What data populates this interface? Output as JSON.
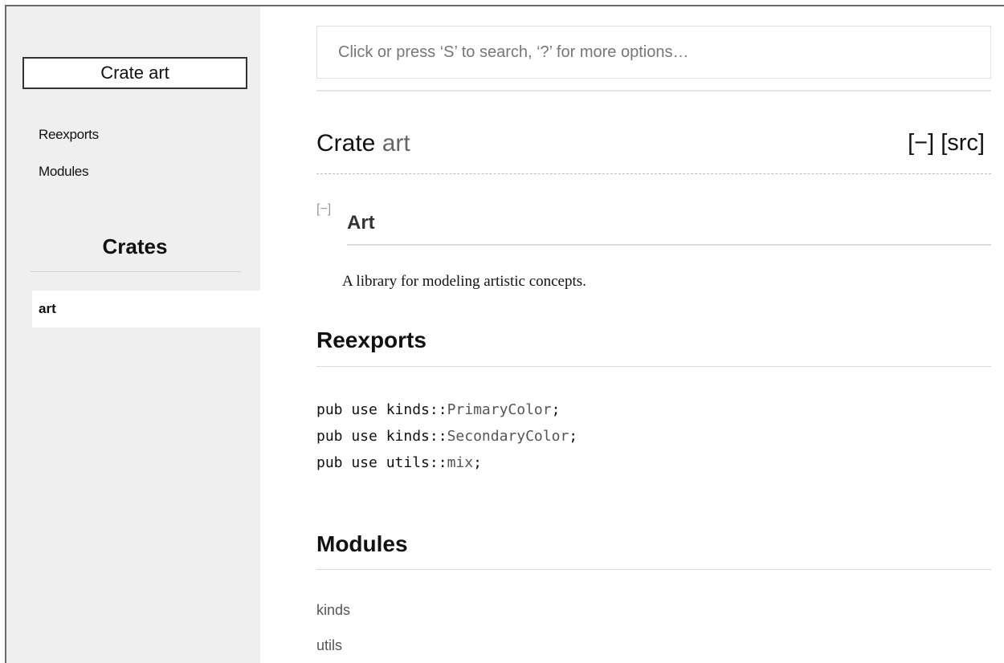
{
  "sidebar": {
    "crate_box_label": "Crate art",
    "links": [
      {
        "label": "Reexports"
      },
      {
        "label": "Modules"
      }
    ],
    "crates_heading": "Crates",
    "crates": [
      {
        "label": "art"
      }
    ]
  },
  "search": {
    "placeholder": "Click or press ‘S’ to search, ‘?’ for more options…"
  },
  "header": {
    "title_prefix": "Crate ",
    "title_name": "art",
    "collapse_label": "[−]",
    "src_label": "[src]"
  },
  "docblock": {
    "collapse_label": "[−]",
    "heading": "Art",
    "text": "A library for modeling artistic concepts."
  },
  "reexports": {
    "heading": "Reexports",
    "lines": [
      {
        "prefix": "pub use kinds::",
        "item": "PrimaryColor",
        "suffix": ";"
      },
      {
        "prefix": "pub use kinds::",
        "item": "SecondaryColor",
        "suffix": ";"
      },
      {
        "prefix": "pub use utils::",
        "item": "mix",
        "suffix": ";"
      }
    ]
  },
  "modules": {
    "heading": "Modules",
    "items": [
      {
        "label": "kinds"
      },
      {
        "label": "utils"
      }
    ]
  }
}
